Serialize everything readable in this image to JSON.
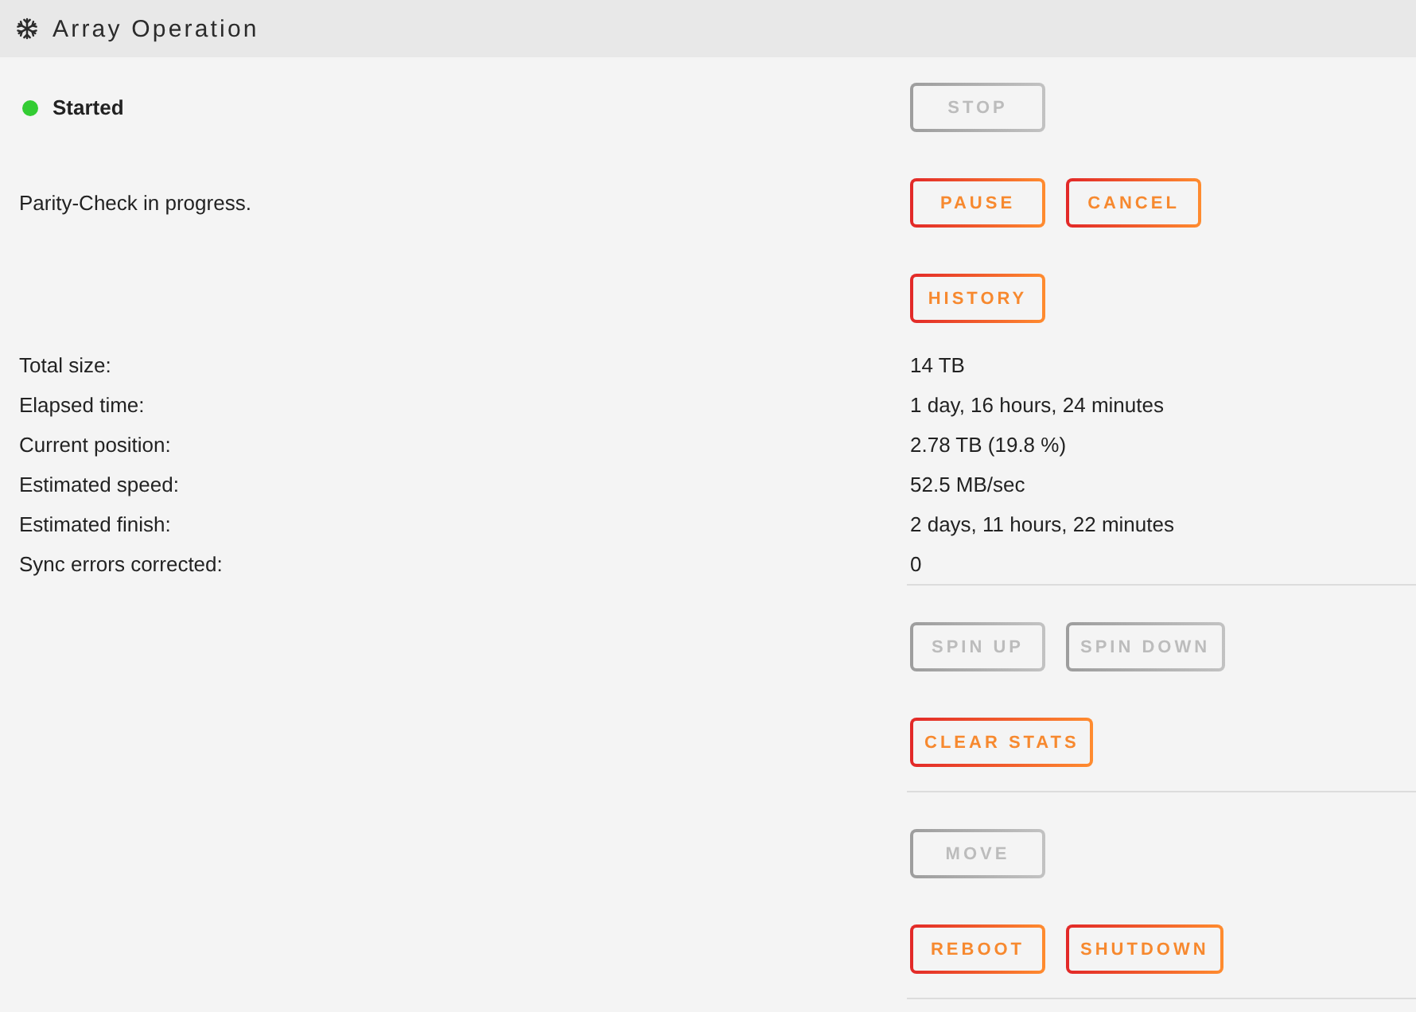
{
  "window": {
    "title": "Array Operation"
  },
  "sections": [
    {
      "rows": [
        {
          "kind": "status",
          "text": "Started",
          "color": "#33cc33",
          "buttons": [
            {
              "label": "STOP",
              "disabled": true
            }
          ]
        },
        {
          "kind": "message",
          "text": "Parity-Check in progress.",
          "buttons": [
            {
              "label": "PAUSE",
              "disabled": false
            },
            {
              "label": "CANCEL",
              "disabled": false
            }
          ]
        },
        {
          "kind": "actions",
          "buttons": [
            {
              "label": "HISTORY",
              "disabled": false
            }
          ]
        }
      ],
      "details": [
        {
          "label": "Total size:",
          "value": "14 TB"
        },
        {
          "label": "Elapsed time:",
          "value": "1 day, 16 hours, 24 minutes"
        },
        {
          "label": "Current position:",
          "value": "2.78 TB (19.8 %)"
        },
        {
          "label": "Estimated speed:",
          "value": "52.5 MB/sec"
        },
        {
          "label": "Estimated finish:",
          "value": "2 days, 11 hours, 22 minutes"
        },
        {
          "label": "Sync errors corrected:",
          "value": "0"
        }
      ]
    },
    {
      "rows": [
        {
          "kind": "actions",
          "buttons": [
            {
              "label": "SPIN UP",
              "disabled": true
            },
            {
              "label": "SPIN DOWN",
              "disabled": true
            }
          ]
        },
        {
          "kind": "actions",
          "buttons": [
            {
              "label": "CLEAR STATS",
              "disabled": false
            }
          ]
        }
      ]
    },
    {
      "rows": [
        {
          "kind": "actions",
          "buttons": [
            {
              "label": "MOVE",
              "disabled": true
            }
          ]
        },
        {
          "kind": "actions",
          "buttons": [
            {
              "label": "REBOOT",
              "disabled": false
            },
            {
              "label": "SHUTDOWN",
              "disabled": false
            }
          ]
        }
      ]
    }
  ]
}
